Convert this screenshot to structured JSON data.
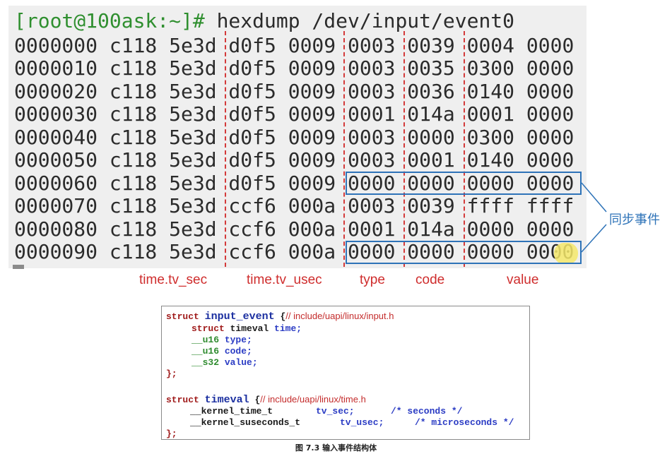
{
  "terminal": {
    "prompt": "[root@100ask:~]#",
    "command": " hexdump /dev/input/event0",
    "rows": [
      "0000000 c118 5e3d d0f5 0009 0003 0039 0004 0000",
      "0000010 c118 5e3d d0f5 0009 0003 0035 0300 0000",
      "0000020 c118 5e3d d0f5 0009 0003 0036 0140 0000",
      "0000030 c118 5e3d d0f5 0009 0001 014a 0001 0000",
      "0000040 c118 5e3d d0f5 0009 0003 0000 0300 0000",
      "0000050 c118 5e3d d0f5 0009 0003 0001 0140 0000",
      "0000060 c118 5e3d d0f5 0009 0000 0000 0000 0000",
      "0000070 c118 5e3d ccf6 000a 0003 0039 ffff ffff",
      "0000080 c118 5e3d ccf6 000a 0001 014a 0000 0000",
      "0000090 c118 5e3d ccf6 000a 0000 0000 0000 0000"
    ]
  },
  "labels": {
    "tv_sec": "time.tv_sec",
    "tv_usec": "time.tv_usec",
    "type": "type",
    "code": "code",
    "value": "value",
    "sync_event": "同步事件"
  },
  "code": {
    "l1_kw": "struct",
    "l1_id": "input_event",
    "l1_brace": " {",
    "l1_comment": "// include/uapi/linux/input.h",
    "l2_kw": "struct",
    "l2_type": " timeval",
    "l2_name": " time;",
    "l3_type": "__u16",
    "l3_name": " type;",
    "l4_type": "__u16",
    "l4_name": " code;",
    "l5_type": "__s32",
    "l5_name": " value;",
    "l6": "};",
    "l7_kw": "struct",
    "l7_id": "timeval",
    "l7_brace": " {",
    "l7_comment": "// include/uapi/linux/time.h",
    "l8_type": "__kernel_time_t",
    "l8_name": "tv_sec;",
    "l8_comment": "/* seconds */",
    "l9_type": "__kernel_suseconds_t",
    "l9_name": "tv_usec;",
    "l9_comment": "/* microseconds */",
    "l10": "};"
  },
  "caption": "图 7.3 输入事件结构体",
  "colors": {
    "prompt": "#2f8f2f",
    "divider": "#d43a3a",
    "sync_box": "#2e73b8"
  }
}
